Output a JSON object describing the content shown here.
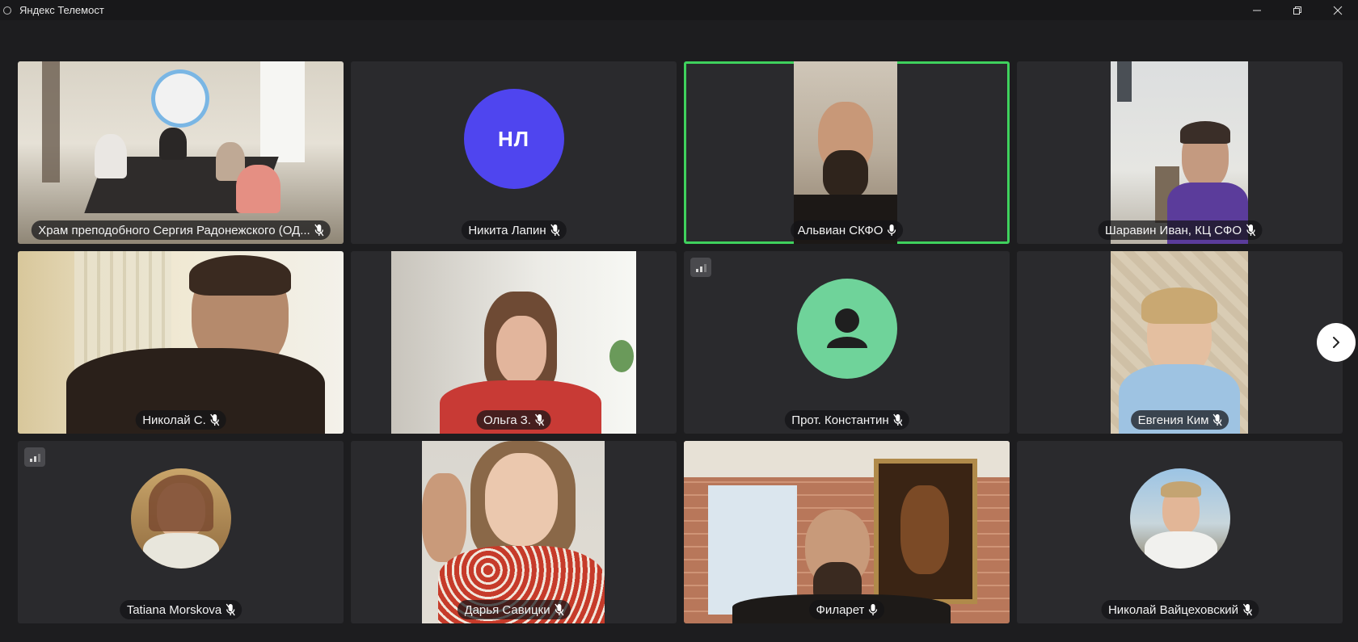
{
  "window": {
    "title": "Яндекс Телемост"
  },
  "icons": {
    "app": "telemost-icon",
    "minimize": "minimize-icon",
    "restore": "restore-icon",
    "close": "close-icon",
    "mic": "microphone-icon",
    "next": "chevron-right-icon",
    "signal": "signal-icon",
    "person": "person-icon"
  },
  "colors": {
    "speaking_border": "#3fd15d",
    "initials_avatar": "#4f45ef",
    "default_avatar": "#6fd39a",
    "background": "#1d1d1f",
    "tile": "#2a2a2d"
  },
  "participants": [
    {
      "name": "Храм преподобного Сергия Радонежского (ОД...",
      "type": "video"
    },
    {
      "name": "Никита Лапин",
      "type": "initials",
      "initials": "НЛ"
    },
    {
      "name": "Альвиан СКФО",
      "type": "video",
      "speaking": true
    },
    {
      "name": "Шаравин Иван, КЦ СФО",
      "type": "video"
    },
    {
      "name": "Николай С.",
      "type": "video"
    },
    {
      "name": "Ольга З.",
      "type": "video"
    },
    {
      "name": "Прот. Константин",
      "type": "default-avatar",
      "weak_signal": true
    },
    {
      "name": "Евгения Ким",
      "type": "video"
    },
    {
      "name": "Tatiana Morskova",
      "type": "photo-avatar",
      "weak_signal": true
    },
    {
      "name": "Дарья Савицки",
      "type": "video"
    },
    {
      "name": "Филарет",
      "type": "video"
    },
    {
      "name": "Николай Вайцеховский",
      "type": "photo-avatar"
    }
  ]
}
